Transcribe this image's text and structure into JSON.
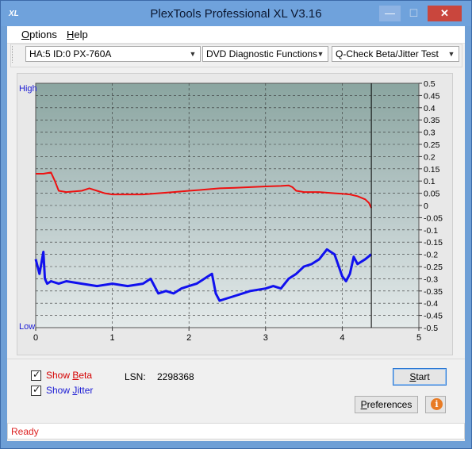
{
  "window": {
    "app_icon_text": "XL",
    "title": "PlexTools Professional XL V3.16",
    "min_glyph": "—",
    "max_glyph": "☐",
    "close_glyph": "✕"
  },
  "menu": {
    "items": [
      {
        "underline": "O",
        "rest": "ptions"
      },
      {
        "underline": "H",
        "rest": "elp"
      }
    ]
  },
  "toolbar": {
    "drive_select": "HA:5 ID:0  PX-760A",
    "function_select": "DVD Diagnostic Functions",
    "test_select": "Q-Check Beta/Jitter Test",
    "arrow_glyph": "▼"
  },
  "chart": {
    "left_axis_high": "High",
    "left_axis_low": "Low",
    "x_ticks": [
      "0",
      "1",
      "2",
      "3",
      "4",
      "5"
    ],
    "y_right_ticks": [
      "0.5",
      "0.45",
      "0.4",
      "0.35",
      "0.3",
      "0.25",
      "0.2",
      "0.15",
      "0.1",
      "0.05",
      "0",
      "-0.05",
      "-0.1",
      "-0.15",
      "-0.2",
      "-0.25",
      "-0.3",
      "-0.35",
      "-0.4",
      "-0.45",
      "-0.5"
    ]
  },
  "chart_data": {
    "type": "line",
    "xlim": [
      0,
      5
    ],
    "ylim": [
      -0.5,
      0.5
    ],
    "grid": true,
    "end_marker_x": 4.38,
    "series": [
      {
        "color": "#ee1111",
        "x": [
          0,
          0.1,
          0.2,
          0.25,
          0.3,
          0.4,
          0.6,
          0.7,
          0.8,
          0.9,
          1.0,
          1.2,
          1.4,
          1.6,
          1.8,
          2.0,
          2.2,
          2.4,
          2.6,
          2.8,
          3.0,
          3.2,
          3.3,
          3.35,
          3.4,
          3.5,
          3.7,
          3.9,
          4.0,
          4.1,
          4.2,
          4.3,
          4.35,
          4.38
        ],
        "y": [
          0.13,
          0.13,
          0.135,
          0.1,
          0.06,
          0.055,
          0.06,
          0.07,
          0.06,
          0.05,
          0.045,
          0.045,
          0.045,
          0.05,
          0.055,
          0.06,
          0.065,
          0.07,
          0.072,
          0.075,
          0.078,
          0.08,
          0.082,
          0.075,
          0.06,
          0.055,
          0.055,
          0.05,
          0.048,
          0.045,
          0.038,
          0.025,
          0.01,
          -0.01
        ]
      },
      {
        "color": "#1111ee",
        "x": [
          0,
          0.05,
          0.1,
          0.12,
          0.15,
          0.2,
          0.3,
          0.4,
          0.6,
          0.8,
          1.0,
          1.2,
          1.4,
          1.5,
          1.6,
          1.7,
          1.8,
          1.9,
          2.0,
          2.1,
          2.2,
          2.3,
          2.35,
          2.4,
          2.5,
          2.6,
          2.7,
          2.8,
          3.0,
          3.1,
          3.2,
          3.3,
          3.4,
          3.5,
          3.6,
          3.7,
          3.8,
          3.9,
          4.0,
          4.05,
          4.1,
          4.15,
          4.2,
          4.3,
          4.38
        ],
        "y": [
          -0.22,
          -0.28,
          -0.19,
          -0.3,
          -0.32,
          -0.31,
          -0.32,
          -0.31,
          -0.32,
          -0.33,
          -0.32,
          -0.33,
          -0.32,
          -0.3,
          -0.36,
          -0.35,
          -0.36,
          -0.34,
          -0.33,
          -0.32,
          -0.3,
          -0.28,
          -0.36,
          -0.39,
          -0.38,
          -0.37,
          -0.36,
          -0.35,
          -0.34,
          -0.33,
          -0.34,
          -0.3,
          -0.28,
          -0.25,
          -0.24,
          -0.22,
          -0.18,
          -0.2,
          -0.29,
          -0.31,
          -0.28,
          -0.21,
          -0.24,
          -0.22,
          -0.2
        ]
      }
    ]
  },
  "options": {
    "show_beta": {
      "checked": true,
      "label_prefix": "Show ",
      "label_underline": "B",
      "label_rest": "eta",
      "color": "#d40000"
    },
    "show_jitter": {
      "checked": true,
      "label_prefix": "Show ",
      "label_underline": "J",
      "label_rest": "itter",
      "color": "#1a1ad4"
    },
    "check_glyph": "✓"
  },
  "lsn": {
    "label": "LSN:",
    "value": "2298368"
  },
  "buttons": {
    "start": {
      "underline": "S",
      "rest": "tart"
    },
    "preferences": {
      "underline": "P",
      "rest": "references"
    },
    "info_glyph": "i"
  },
  "status": {
    "text": "Ready"
  }
}
